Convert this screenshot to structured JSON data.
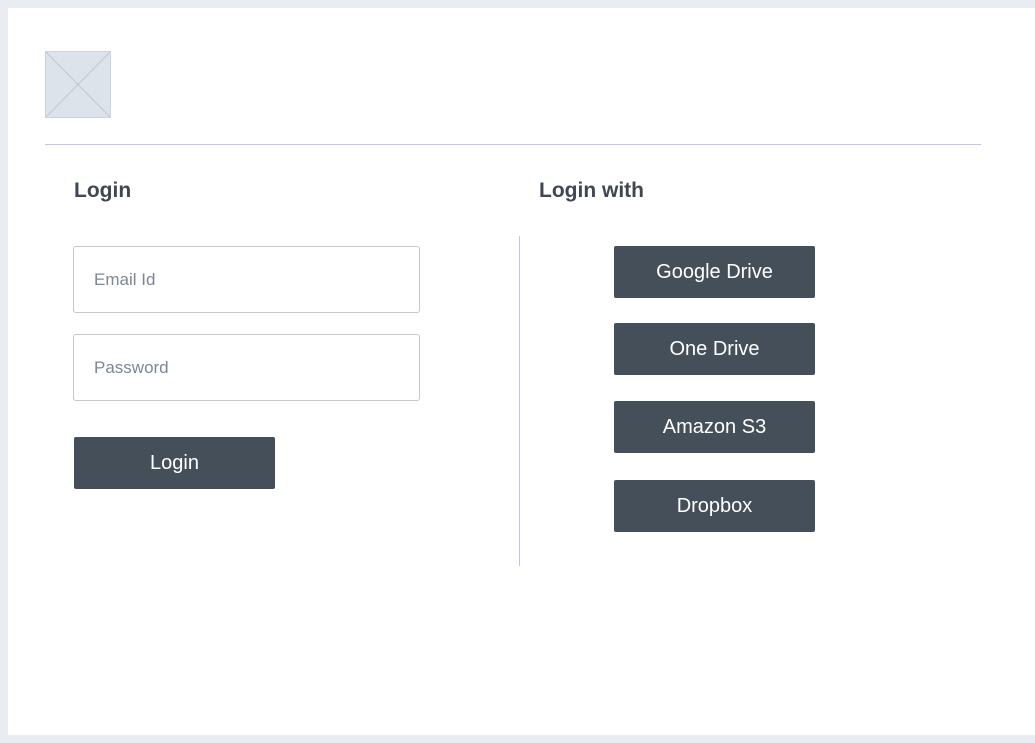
{
  "header": {
    "logo_icon": "image-placeholder-icon"
  },
  "login": {
    "title": "Login",
    "email_placeholder": "Email Id",
    "email_value": "",
    "password_placeholder": "Password",
    "password_value": "",
    "submit_label": "Login"
  },
  "login_with": {
    "title": "Login with",
    "providers": [
      {
        "label": "Google Drive"
      },
      {
        "label": "One Drive"
      },
      {
        "label": "Amazon S3"
      },
      {
        "label": "Dropbox"
      }
    ]
  },
  "colors": {
    "button_bg": "#454f5a",
    "divider": "#c5c0ee",
    "page_bg": "#e9edf2"
  }
}
